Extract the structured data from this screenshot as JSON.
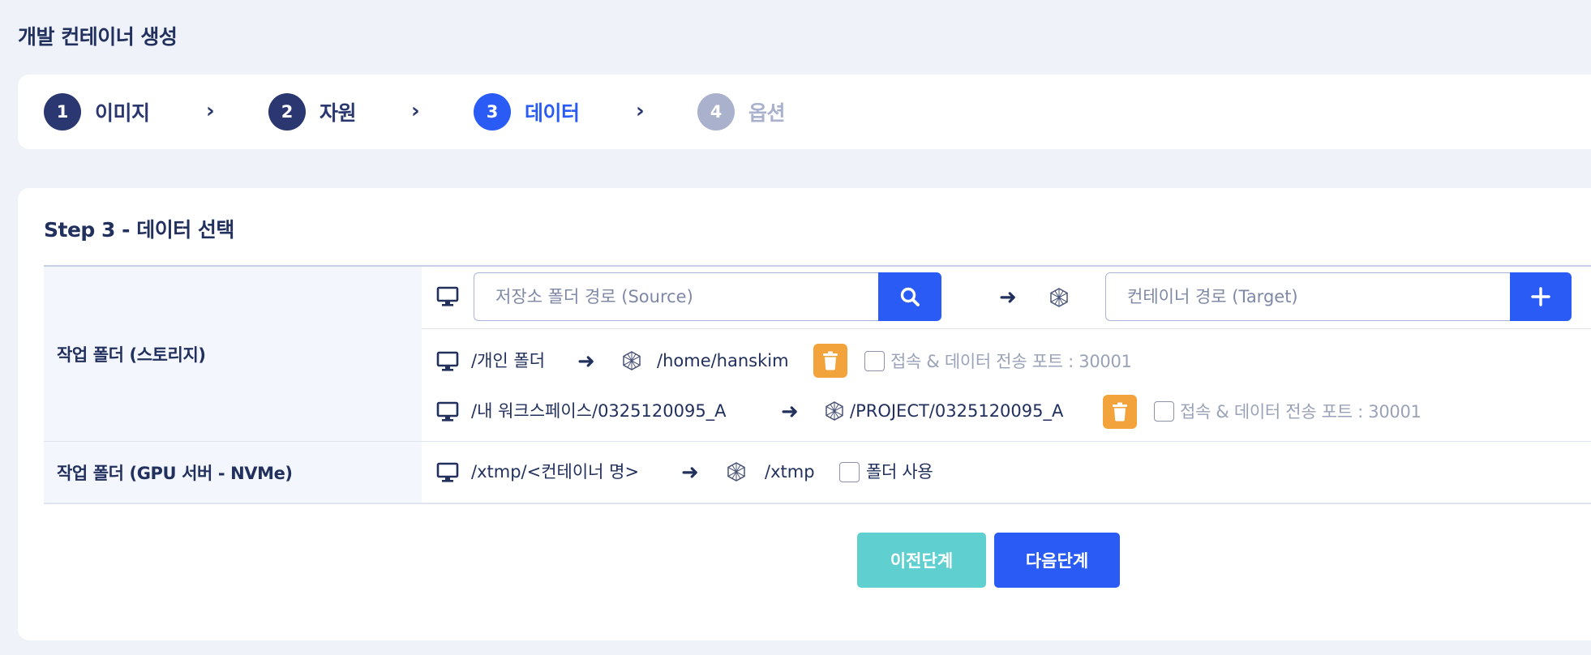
{
  "page": {
    "title": "개발 컨테이너 생성"
  },
  "stepper": {
    "steps": [
      {
        "number": "1",
        "label": "이미지",
        "state": "done"
      },
      {
        "number": "2",
        "label": "자원",
        "state": "done"
      },
      {
        "number": "3",
        "label": "데이터",
        "state": "active"
      },
      {
        "number": "4",
        "label": "옵션",
        "state": "todo"
      }
    ],
    "separator": "›"
  },
  "card": {
    "title": "Step 3 - 데이터 선택",
    "storage_row": {
      "header": "작업 폴더 (스토리지)",
      "source_placeholder": "저장소 폴더 경로 (Source)",
      "target_placeholder": "컨테이너 경로 (Target)",
      "mappings": [
        {
          "source": "/개인 폴더",
          "target": "/home/hanskim",
          "port_label": "접속 & 데이터 전송 포트 : 30001"
        },
        {
          "source": "/내 워크스페이스/0325120095_A",
          "target": "/PROJECT/0325120095_A",
          "port_label": "접속 & 데이터 전송 포트 : 30001"
        }
      ]
    },
    "nvme_row": {
      "header": "작업 폴더 (GPU 서버 - NVMe)",
      "source": "/xtmp/<컨테이너 명>",
      "target": "/xtmp",
      "checkbox_label": "폴더 사용"
    },
    "buttons": {
      "prev": "이전단계",
      "next": "다음단계"
    }
  },
  "arrow": "➜",
  "colors": {
    "accent": "#2a5cf5",
    "navy": "#22305e",
    "trash": "#f3a33b",
    "prev_button": "#5fd0cf",
    "disabled_step": "#a9b1cd",
    "background": "#eff2f9"
  }
}
